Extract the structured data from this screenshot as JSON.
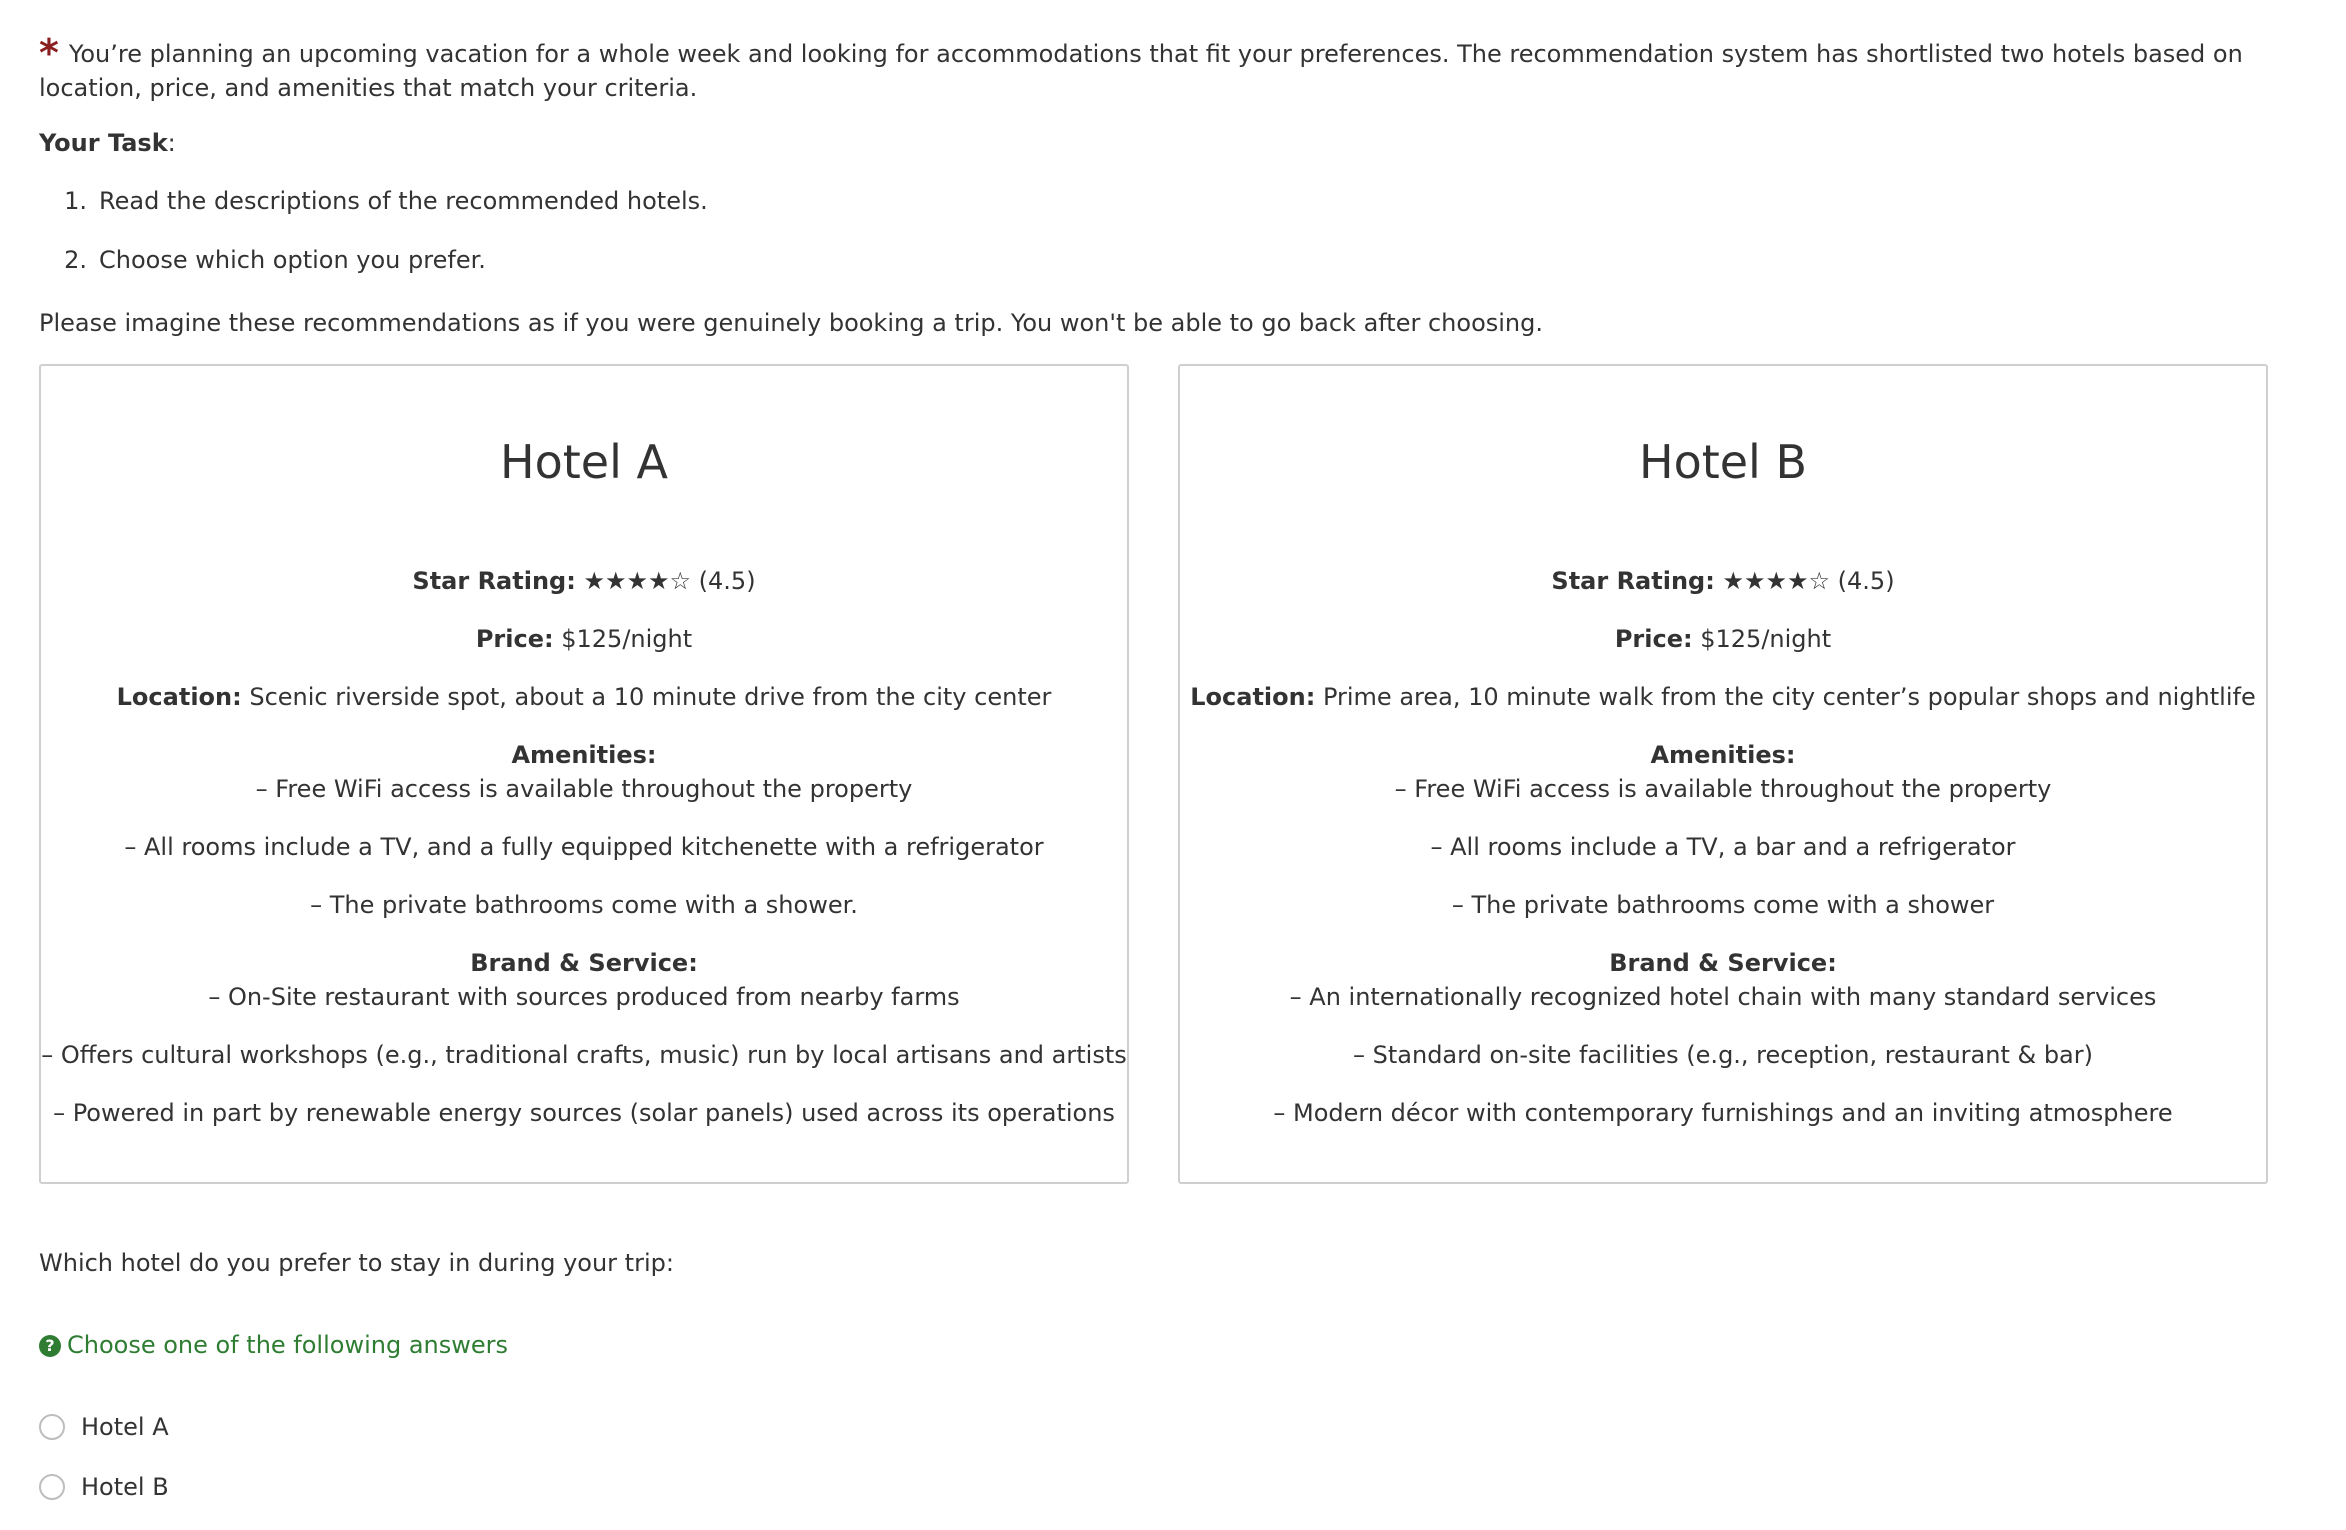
{
  "intro": {
    "asterisk": "*",
    "text": "You’re planning an upcoming vacation for a whole week and looking for accommodations that fit your preferences. The recommendation system has shortlisted two hotels based on location, price, and amenities that match your criteria."
  },
  "task": {
    "label": "Your Task",
    "colon": ":",
    "steps": [
      {
        "num": "1.",
        "text": "Read the descriptions of the recommended hotels."
      },
      {
        "num": "2.",
        "text": "Choose which option you prefer."
      }
    ]
  },
  "imagine": "Please imagine these recommendations as if you were genuinely booking a trip. You won't be able to go back after choosing.",
  "hotels": [
    {
      "title": "Hotel A",
      "star_label": "Star Rating:",
      "stars": "★★★★☆",
      "rating": "(4.5)",
      "price_label": "Price:",
      "price": "$125/night",
      "location_label": "Location:",
      "location": "Scenic riverside spot, about a 10 minute drive from the city center",
      "amenities_label": "Amenities:",
      "amenities": [
        "– Free WiFi access is available throughout the property",
        "– All rooms include a TV, and a fully equipped kitchenette with a refrigerator",
        "– The private bathrooms come with a shower."
      ],
      "brand_label": "Brand & Service:",
      "brand": [
        "– On-Site restaurant with sources produced from nearby farms",
        "– Offers cultural workshops (e.g., traditional crafts, music) run by local artisans and artists",
        "– Powered in part by renewable energy sources (solar panels) used across its operations"
      ]
    },
    {
      "title": "Hotel B",
      "star_label": "Star Rating:",
      "stars": "★★★★☆",
      "rating": "(4.5)",
      "price_label": "Price:",
      "price": "$125/night",
      "location_label": "Location:",
      "location": "Prime area, 10 minute walk from the city center’s popular shops and nightlife",
      "amenities_label": "Amenities:",
      "amenities": [
        "– Free WiFi access is available throughout the property",
        "– All rooms include a TV, a bar and a refrigerator",
        "– The private bathrooms come with a shower"
      ],
      "brand_label": "Brand & Service:",
      "brand": [
        "– An internationally recognized hotel chain with many standard services",
        "– Standard on-site facilities (e.g., reception, restaurant & bar)",
        "– Modern décor with contemporary furnishings and an inviting atmosphere"
      ]
    }
  ],
  "question": "Which hotel do you prefer to stay in during your trip:",
  "hint": {
    "icon": "question-circle-icon",
    "icon_glyph": "?",
    "text": "Choose one of the following answers",
    "color": "#2e7d32"
  },
  "answers": [
    {
      "label": "Hotel A",
      "selected": false
    },
    {
      "label": "Hotel B",
      "selected": false
    }
  ],
  "colors": {
    "text": "#333333",
    "asterisk": "#8b1f1f",
    "border": "#cfcfcf",
    "radio_border": "#bdbdbd"
  }
}
